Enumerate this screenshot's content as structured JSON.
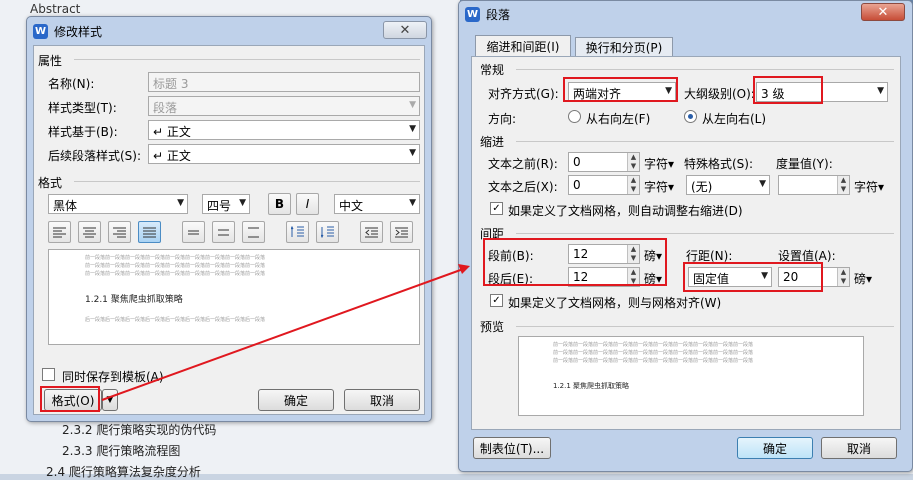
{
  "background": {
    "abstract": "Abstract",
    "toc": [
      "2.3.2  爬行策略实现的伪代码",
      "2.3.3  爬行策略流程图",
      "2.4  爬行策略算法复杂度分析"
    ]
  },
  "modify_style": {
    "title": "修改样式",
    "close": "✕",
    "properties_label": "属性",
    "name_label": "名称(N):",
    "name_value": "标题 3",
    "type_label": "样式类型(T):",
    "type_value": "段落",
    "based_label": "样式基于(B):",
    "based_value": "↵ 正文",
    "next_label": "后续段落样式(S):",
    "next_value": "↵ 正文",
    "format_label": "格式",
    "font": "黑体",
    "size": "四号",
    "bold": "B",
    "italic": "I",
    "lang": "中文",
    "preview": {
      "prev": "前一段落前一段落前一段落前一段落前一段落前一段落前一段落前一段落前一段落",
      "heading": "1.2.1  聚焦爬虫抓取策略",
      "next": "后一段落后一段落后一段落后一段落后一段落后一段落后一段落后一段落后一段落"
    },
    "save_template": "同时保存到模板(A)",
    "format_button": "格式(O)",
    "ok": "确定",
    "cancel": "取消"
  },
  "paragraph": {
    "title": "段落",
    "close": "✕",
    "tabs": [
      "缩进和间距(I)",
      "换行和分页(P)"
    ],
    "general_label": "常规",
    "align_label": "对齐方式(G):",
    "align_value": "两端对齐",
    "outline_label": "大纲级别(O):",
    "outline_value": "3 级",
    "direction_label": "方向:",
    "rtl": "从右向左(F)",
    "ltr": "从左向右(L)",
    "indent_label": "缩进",
    "before_text_label": "文本之前(R):",
    "before_text_value": "0",
    "after_text_label": "文本之后(X):",
    "after_text_value": "0",
    "char_unit": "字符▾",
    "special_label": "特殊格式(S):",
    "special_value": "(无)",
    "measure_label": "度量值(Y):",
    "measure_value": "",
    "grid_indent": "如果定义了文档网格，则自动调整右缩进(D)",
    "spacing_label": "间距",
    "before_label": "段前(B):",
    "before_value": "12",
    "after_label": "段后(E):",
    "after_value": "12",
    "pt_unit": "磅▾",
    "line_label": "行距(N):",
    "line_value": "固定值",
    "set_label": "设置值(A):",
    "set_value": "20",
    "grid_align": "如果定义了文档网格，则与网格对齐(W)",
    "preview_label": "预览",
    "preview": {
      "prev": "前一段落前一段落前一段落前一段落前一段落前一段落前一段落前一段落前一段落前一段落",
      "heading": "1.2.1 聚焦爬虫抓取策略"
    },
    "tabs_button": "制表位(T)...",
    "ok": "确定",
    "cancel": "取消"
  },
  "colors": {
    "highlight": "#e0181f",
    "title_bar": "#bfd1ea",
    "accent": "#2a68c9"
  }
}
